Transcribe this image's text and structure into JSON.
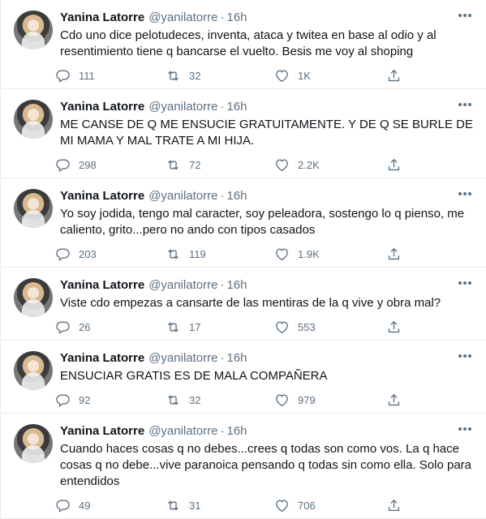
{
  "tweets": [
    {
      "name": "Yanina Latorre",
      "handle": "@yanilatorre",
      "separator": "·",
      "time": "16h",
      "text": "Cdo uno dice pelotudeces, inventa, ataca y twitea en base al odio y al resentimiento tiene q bancarse el vuelto. Besis me voy al shoping",
      "replies": "111",
      "retweets": "32",
      "likes": "1K"
    },
    {
      "name": "Yanina Latorre",
      "handle": "@yanilatorre",
      "separator": "·",
      "time": "16h",
      "text": "ME CANSE DE Q ME ENSUCIE GRATUITAMENTE. Y DE Q SE BURLE DE MI MAMA Y MAL TRATE A MI HIJA.",
      "replies": "298",
      "retweets": "72",
      "likes": "2.2K"
    },
    {
      "name": "Yanina Latorre",
      "handle": "@yanilatorre",
      "separator": "·",
      "time": "16h",
      "text": "Yo soy jodida, tengo mal caracter, soy peleadora, sostengo lo q pienso, me caliento, grito...pero no ando con tipos casados",
      "replies": "203",
      "retweets": "119",
      "likes": "1.9K"
    },
    {
      "name": "Yanina Latorre",
      "handle": "@yanilatorre",
      "separator": "·",
      "time": "16h",
      "text": "Viste cdo empezas a cansarte de las mentiras de la q vive y obra mal?",
      "replies": "26",
      "retweets": "17",
      "likes": "553"
    },
    {
      "name": "Yanina Latorre",
      "handle": "@yanilatorre",
      "separator": "·",
      "time": "16h",
      "text": "ENSUCIAR GRATIS ES DE MALA COMPAÑERA",
      "replies": "92",
      "retweets": "32",
      "likes": "979"
    },
    {
      "name": "Yanina Latorre",
      "handle": "@yanilatorre",
      "separator": "·",
      "time": "16h",
      "text": "Cuando haces cosas q no debes...crees q todas son como vos. La q hace cosas q no debe...vive paranoica pensando q todas sin como ella. Solo para entendidos",
      "replies": "49",
      "retweets": "31",
      "likes": "706"
    }
  ],
  "icons": {
    "reply": "reply-icon",
    "retweet": "retweet-icon",
    "like": "like-icon",
    "share": "share-icon",
    "more": "more-icon"
  },
  "colors": {
    "text": "#0f1419",
    "secondary": "#5b7083",
    "border": "#e6ecf0"
  }
}
